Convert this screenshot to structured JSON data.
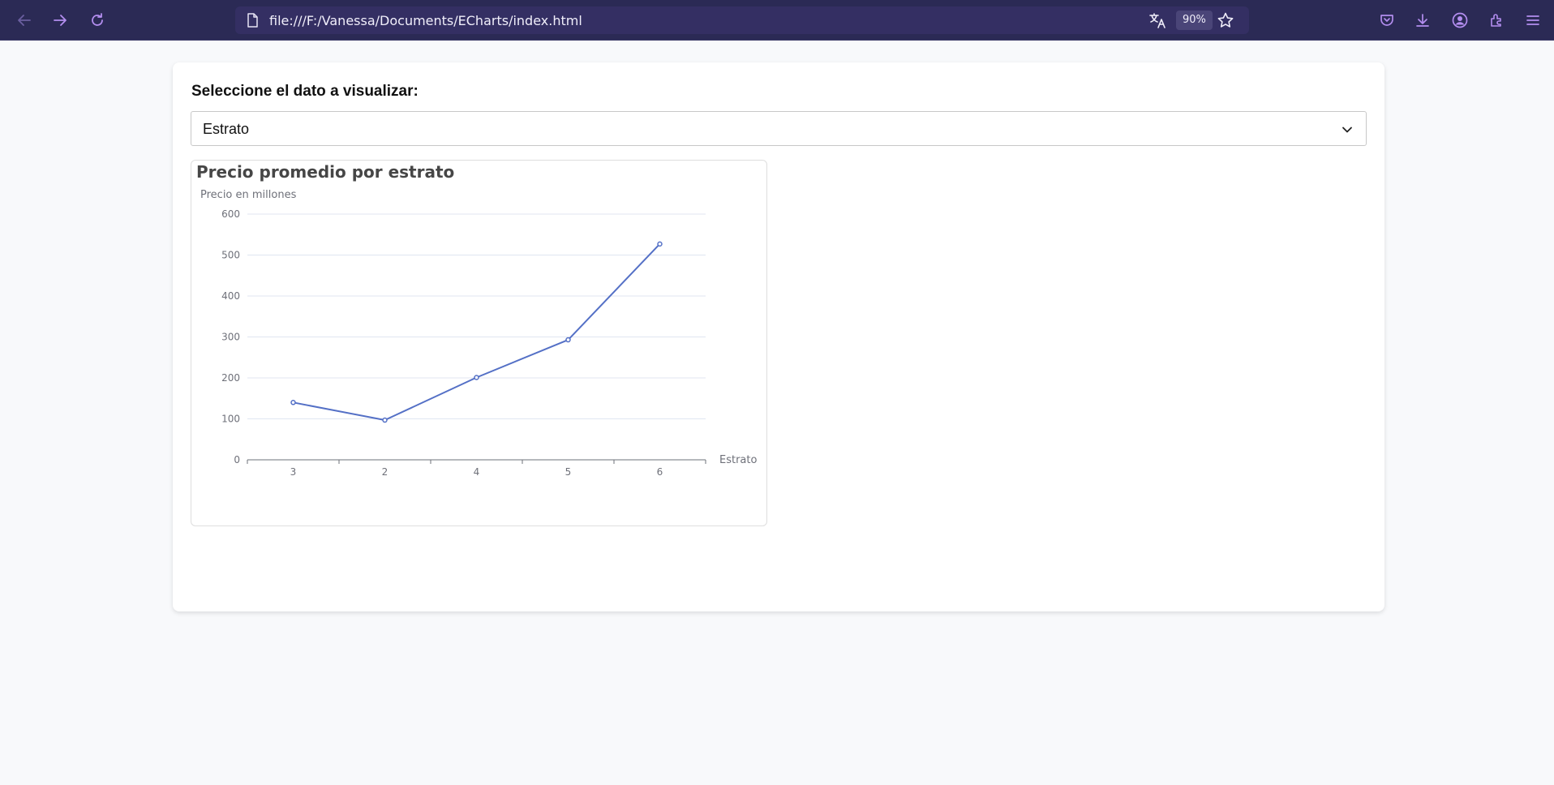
{
  "browser": {
    "url": "file:///F:/Vanessa/Documents/ECharts/index.html",
    "zoom": "90%",
    "icons": {
      "back": "back-arrow-icon",
      "forward": "forward-arrow-icon",
      "reload": "reload-icon",
      "page": "page-icon",
      "translate": "translate-icon",
      "bookmark": "star-icon",
      "pocket": "pocket-icon",
      "downloads": "download-icon",
      "account": "account-icon",
      "extensions": "extensions-icon",
      "menu": "hamburger-menu-icon"
    },
    "colors": {
      "toolbar": "#2b2a55",
      "accent": "#b48ef0"
    }
  },
  "form": {
    "label": "Seleccione el dato a visualizar:",
    "selected": "Estrato"
  },
  "chart_data": {
    "type": "line",
    "title": "Precio promedio por estrato",
    "ylabel": "Precio en millones",
    "xlabel": "Estrato",
    "categories": [
      "3",
      "2",
      "4",
      "5",
      "6"
    ],
    "series": [
      {
        "values": [
          140,
          97,
          201,
          293,
          527
        ]
      }
    ],
    "ylim": [
      0,
      600
    ],
    "yticks": [
      "0",
      "100",
      "200",
      "300",
      "400",
      "500",
      "600"
    ],
    "grid": true,
    "color": "#5470c6"
  }
}
